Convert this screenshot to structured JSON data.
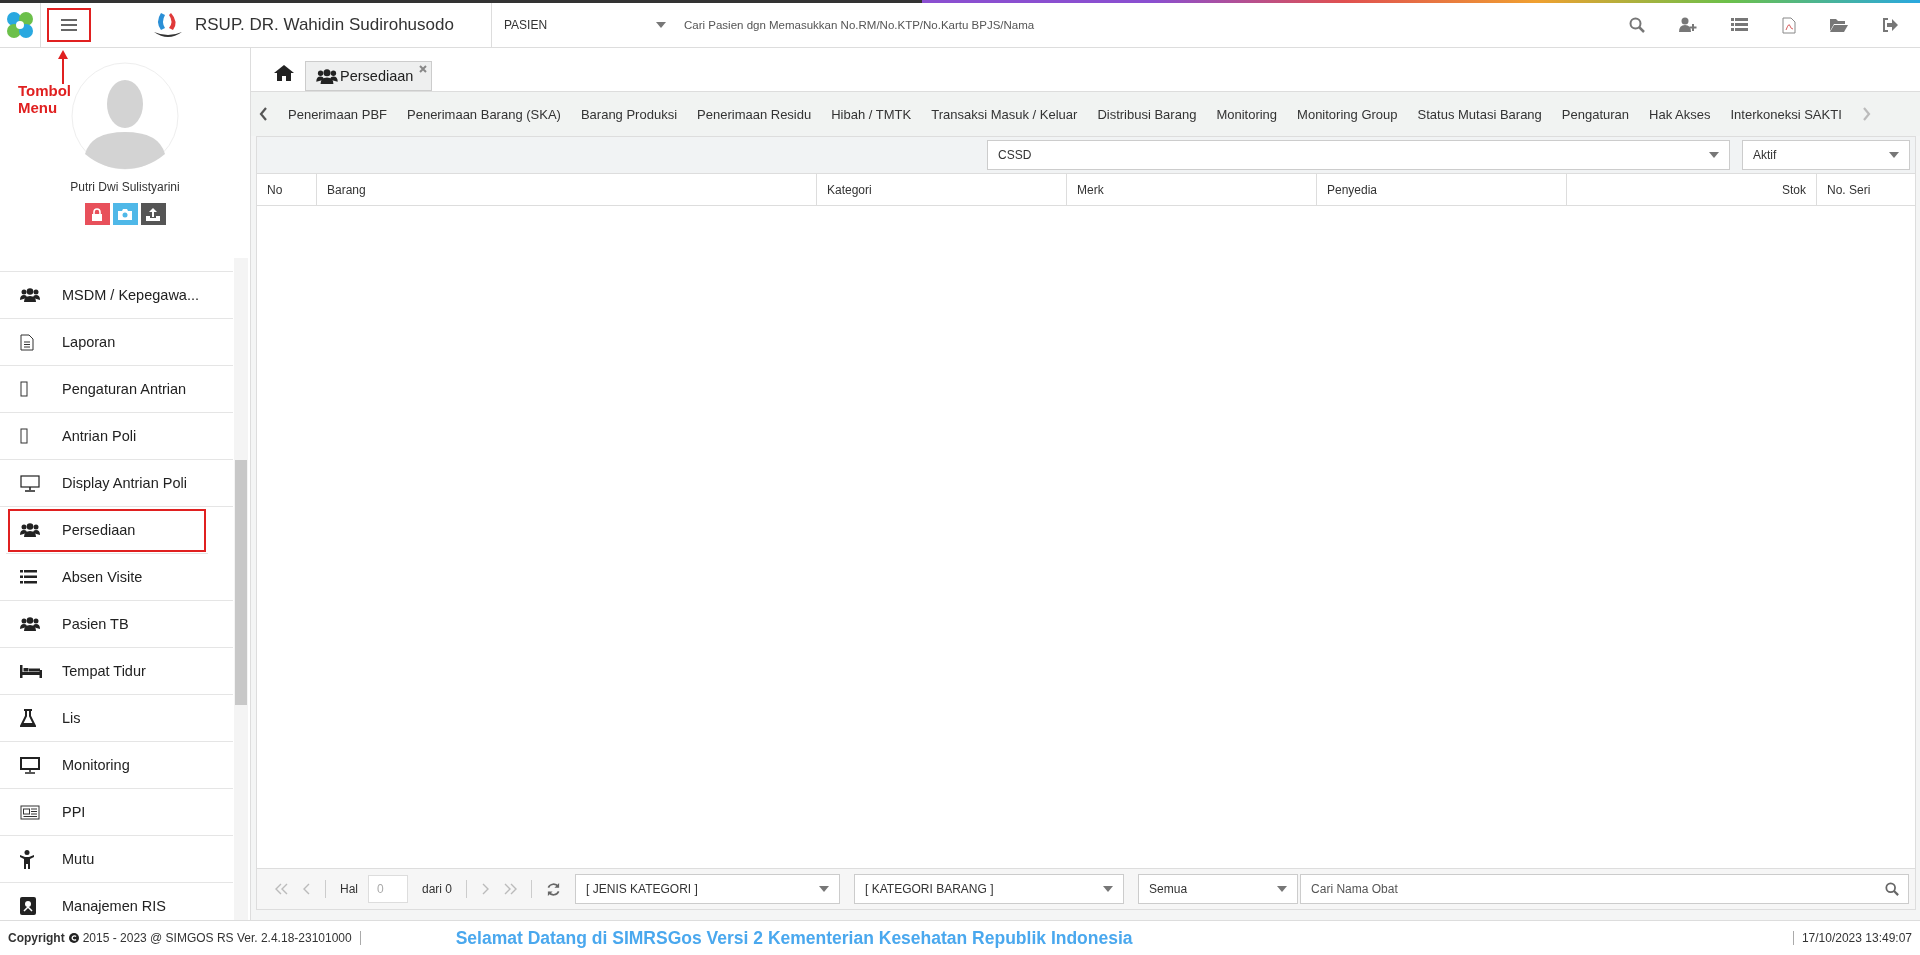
{
  "header": {
    "hospital_name": "RSUP. DR. Wahidin Sudirohusodo",
    "menu_button_highlighted": true,
    "search_type": "PASIEN",
    "search": {
      "placeholder": "Cari Pasien dgn Memasukkan No.RM/No.KTP/No.Kartu BPJS/Nama"
    }
  },
  "annotation": {
    "label": "Tombol Menu"
  },
  "user": {
    "name": "Putri Dwi Sulistyarini"
  },
  "sidebar": {
    "items": [
      {
        "label": "MSDM / Kepegawa...",
        "highlighted": false
      },
      {
        "label": "Laporan",
        "highlighted": false
      },
      {
        "label": "Pengaturan Antrian",
        "highlighted": false
      },
      {
        "label": "Antrian Poli",
        "highlighted": false
      },
      {
        "label": "Display Antrian Poli",
        "highlighted": false
      },
      {
        "label": "Persediaan",
        "highlighted": true
      },
      {
        "label": "Absen Visite",
        "highlighted": false
      },
      {
        "label": "Pasien TB",
        "highlighted": false
      },
      {
        "label": "Tempat Tidur",
        "highlighted": false
      },
      {
        "label": "Lis",
        "highlighted": false
      },
      {
        "label": "Monitoring",
        "highlighted": false
      },
      {
        "label": "PPI",
        "highlighted": false
      },
      {
        "label": "Mutu",
        "highlighted": false
      },
      {
        "label": "Manajemen RIS",
        "highlighted": false
      }
    ]
  },
  "tabs": [
    {
      "label": "Persediaan",
      "selected": true
    }
  ],
  "subnav": [
    "Penerimaan PBF",
    "Penerimaan Barang (SKA)",
    "Barang Produksi",
    "Penerimaan Residu",
    "Hibah / TMTK",
    "Transaksi Masuk / Keluar",
    "Distribusi Barang",
    "Monitoring",
    "Monitoring Group",
    "Status Mutasi Barang",
    "Pengaturan",
    "Hak Akses",
    "Interkoneksi SAKTI"
  ],
  "filters": {
    "unit": "CSSD",
    "status": "Aktif"
  },
  "table": {
    "columns": [
      {
        "label": "No"
      },
      {
        "label": "Barang"
      },
      {
        "label": "Kategori"
      },
      {
        "label": "Merk"
      },
      {
        "label": "Penyedia"
      },
      {
        "label": "Stok"
      },
      {
        "label": "No. Seri"
      }
    ]
  },
  "pager": {
    "page_label": "Hal",
    "page": "0",
    "of_label": "dari 0",
    "jenis_kategori": "[ JENIS KATEGORI ]",
    "kategori_barang": "[ KATEGORI BARANG ]",
    "scope": "Semua",
    "search": {
      "placeholder": "Cari Nama Obat"
    }
  },
  "status_bar": {
    "copyright_label": "Copyright",
    "copyright_text": "2015 - 2023 @ SIMGOS RS Ver. 2.4.18-23101000",
    "welcome": "Selamat Datang di SIMRSGos Versi 2 Kementerian Kesehatan Republik Indonesia",
    "datetime": "17/10/2023 13:49:07"
  }
}
